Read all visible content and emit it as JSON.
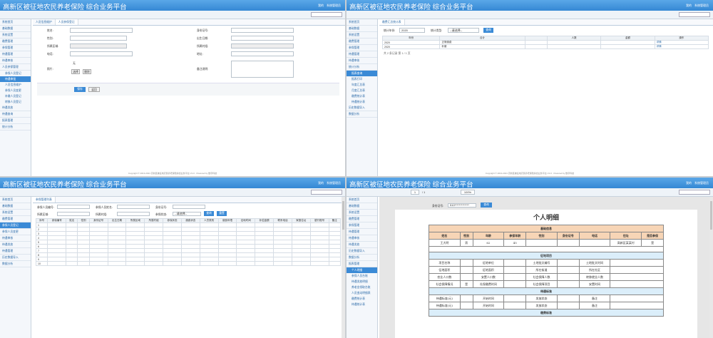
{
  "app": {
    "title": "高新区被征地农民养老保险 综合业务平台",
    "user_links": [
      "我的",
      "系统管理员"
    ],
    "footer": "Copyright © 2013-2021 高新区被征地农民养老保险综合业务平台 V1.0 · Powered by 数字科技"
  },
  "q1": {
    "sidebar": [
      "系统首页",
      "基础数据",
      "系统设置",
      "缴费管理",
      "参保管理",
      "待遇管理",
      "待遇审核",
      "人员参保管理"
    ],
    "sidebar_sub": [
      "参保人员登记",
      "待遇审批",
      "人员信息维护",
      "参保人员变更",
      "补缴人员登记",
      "转移人员登记"
    ],
    "sidebar_tail": [
      "待遇发放",
      "待遇查询",
      "报表管理",
      "统计分析"
    ],
    "tabs": [
      "人员信息维护",
      "人员参保登记"
    ],
    "form": {
      "name": "姓名:",
      "idcard": "身份证号:",
      "gender": "性别:",
      "birth": "出生日期:",
      "area": "所属区域:",
      "village": "所属村组:",
      "phone": "电话:",
      "addr": "地址:",
      "photo": "照片:",
      "photo_val": "无",
      "note": "备注说明:",
      "upload": "选择",
      "del": "删除"
    },
    "submit": "保存",
    "back": "返回"
  },
  "q2": {
    "sidebar": [
      "系统首页",
      "基础数据",
      "系统设置",
      "缴费管理",
      "参保管理",
      "待遇管理",
      "待遇审核",
      "统计分析"
    ],
    "sidebar_sub": [
      "报表查询",
      "报表打印",
      "年度汇总表",
      "月度汇总表",
      "缴费统计表",
      "待遇统计表"
    ],
    "sidebar_tail": [
      "历史数据导入",
      "数据分析"
    ],
    "tab": "缴费汇总统计表",
    "filter": {
      "year_label": "统计年份:",
      "year": "2020",
      "type_label": "统计类型:",
      "type": "--请选择--",
      "btn": "查询"
    },
    "columns": [
      "年份",
      "合计",
      "",
      "人数",
      "金额",
      "操作"
    ],
    "rows": [
      [
        "2020",
        "正常缴费",
        "",
        "",
        "",
        "详情"
      ],
      [
        "2020",
        "补缴",
        "",
        "",
        "",
        "详情"
      ]
    ],
    "pager": "共 2 条记录 第 1 / 1 页"
  },
  "q3": {
    "sidebar": [
      "系统首页",
      "基础数据",
      "系统设置",
      "缴费管理",
      "参保人员登记",
      "参保人员变更",
      "待遇审核",
      "待遇发放",
      "待遇管理",
      "历史数据导入",
      "数据分析"
    ],
    "tab": "参保管理列表",
    "filter": {
      "l1": "参保人员编号:",
      "l2": "参保人员姓名:",
      "l3": "身份证号:",
      "l4": "所属区域:",
      "l5": "所属村组:",
      "l6": "参保状态:",
      "sel": "--请选择--",
      "q": "查询",
      "r": "重置"
    },
    "columns": [
      "序号",
      "参保编号",
      "姓名",
      "性别",
      "身份证号",
      "出生日期",
      "所属区域",
      "所属村组",
      "参保状态",
      "缴费状态",
      "人员类别",
      "缴费年限",
      "征地时间",
      "补偿金额",
      "联系电话",
      "家庭住址",
      "银行账号",
      "备注"
    ],
    "rows": [
      "1",
      "2",
      "3",
      "4",
      "5",
      "6",
      "7",
      "8",
      "9",
      "10"
    ]
  },
  "q4": {
    "sidebar": [
      "系统首页",
      "基础数据",
      "系统设置",
      "缴费管理",
      "参保管理",
      "待遇管理",
      "待遇审核",
      "待遇发放",
      "历史数据导入",
      "数据分析",
      "报表管理"
    ],
    "sidebar_sub": [
      "个人明细",
      "参保人员台账",
      "待遇发放明细",
      "养老金领取台账",
      "人员变动明细表",
      "缴费统计表",
      "待遇统计表"
    ],
    "toolbar": {
      "page": "1",
      "of": "/ 1",
      "zoom": "100%"
    },
    "qlabel": "身份证号:",
    "qval": "510*************",
    "qbtn": "查询",
    "title": "个人明细",
    "sec_base": "基础信息",
    "base_head": [
      "姓名",
      "性别",
      "年龄",
      "参保年龄",
      "性别",
      "身份证号",
      "电话",
      "住址",
      "是否参保"
    ],
    "base_vals": [
      "王大明",
      "男",
      "62",
      "45",
      "",
      "",
      "",
      "高新区某某村",
      "是"
    ],
    "sec_land": "征地项目",
    "land": [
      [
        "项目名称",
        "",
        "征地单位",
        "",
        "土地批文编号",
        "",
        "土地批文时间",
        ""
      ],
      [
        "征地面积",
        "",
        "征地面积",
        "",
        "所在街道",
        "",
        "所在社区",
        ""
      ],
      [
        "农业人口数",
        "",
        "安置人口数",
        "",
        "社会保障人数",
        "",
        "转移就业人数",
        ""
      ],
      [
        "社会保障情况",
        "是",
        "社保缴费时间",
        "",
        "社会保障项目",
        "",
        "安置时间",
        ""
      ]
    ],
    "sec_benefit": "待遇标准",
    "benefit": [
      [
        "待遇标准(元)",
        "",
        "开始时间",
        "",
        "发放状态",
        "",
        "备注",
        ""
      ],
      [
        "待遇标准(元)",
        "",
        "开始时间",
        "",
        "发放状态",
        "",
        "备注",
        ""
      ]
    ],
    "sec_pay": "缴费标准"
  }
}
